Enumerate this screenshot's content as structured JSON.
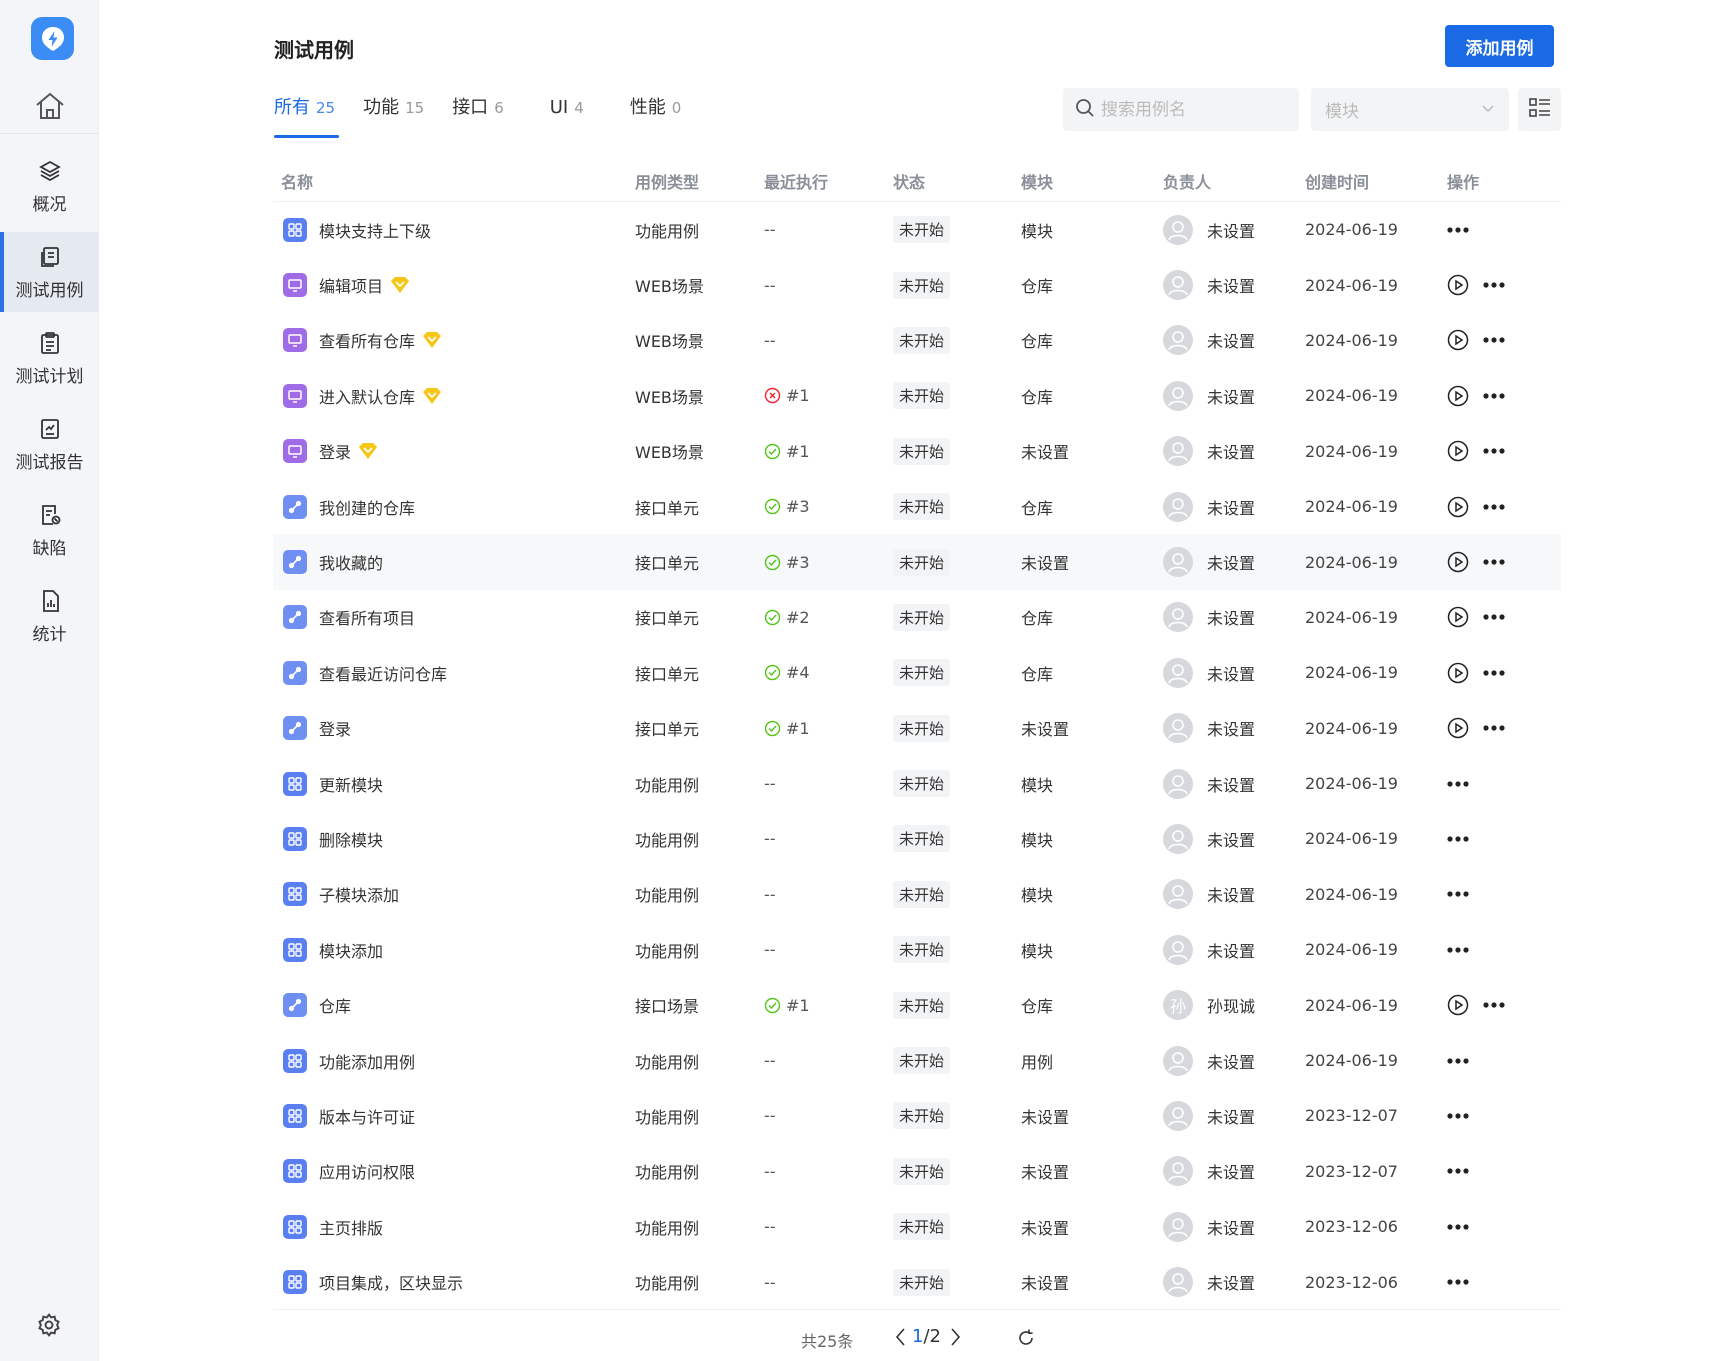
{
  "colors": {
    "primary": "#1b6ae5",
    "sidebar_bg": "#f3f5f8",
    "func_icon": "#5a7ff0",
    "web_icon": "#a06be6",
    "api_icon": "#6f8ff2",
    "vip": "#f5c518",
    "success": "#52c41a",
    "error": "#f5222d"
  },
  "sidebar": {
    "logo_icon": "lightning-logo",
    "home_icon": "home-icon",
    "items": [
      {
        "label": "概况",
        "icon": "layers-icon"
      },
      {
        "label": "测试用例",
        "icon": "test-case-icon",
        "active": true
      },
      {
        "label": "测试计划",
        "icon": "clipboard-icon"
      },
      {
        "label": "测试报告",
        "icon": "report-icon"
      },
      {
        "label": "缺陷",
        "icon": "bug-icon"
      },
      {
        "label": "统计",
        "icon": "chart-icon"
      }
    ],
    "settings_icon": "gear-icon"
  },
  "header": {
    "title": "测试用例",
    "add_button": "添加用例"
  },
  "tabs": [
    {
      "label": "所有",
      "count": "25",
      "active": true
    },
    {
      "label": "功能",
      "count": "15"
    },
    {
      "label": "接口",
      "count": "6"
    },
    {
      "label": "UI",
      "count": "4"
    },
    {
      "label": "性能",
      "count": "0"
    }
  ],
  "filters": {
    "search_placeholder": "搜索用例名",
    "module_placeholder": "模块"
  },
  "table": {
    "columns": [
      "名称",
      "用例类型",
      "最近执行",
      "状态",
      "模块",
      "负责人",
      "创建时间",
      "操作"
    ],
    "rows": [
      {
        "name": "模块支持上下级",
        "kind": "func",
        "vip": false,
        "type": "功能用例",
        "exec": "--",
        "exec_status": "none",
        "status": "未开始",
        "module": "模块",
        "owner": "未设置",
        "avatar": "",
        "date": "2024-06-19",
        "playable": false
      },
      {
        "name": "编辑项目",
        "kind": "web",
        "vip": true,
        "type": "WEB场景",
        "exec": "--",
        "exec_status": "none",
        "status": "未开始",
        "module": "仓库",
        "owner": "未设置",
        "avatar": "",
        "date": "2024-06-19",
        "playable": true
      },
      {
        "name": "查看所有仓库",
        "kind": "web",
        "vip": true,
        "type": "WEB场景",
        "exec": "--",
        "exec_status": "none",
        "status": "未开始",
        "module": "仓库",
        "owner": "未设置",
        "avatar": "",
        "date": "2024-06-19",
        "playable": true
      },
      {
        "name": "进入默认仓库",
        "kind": "web",
        "vip": true,
        "type": "WEB场景",
        "exec": "#1",
        "exec_status": "fail",
        "status": "未开始",
        "module": "仓库",
        "owner": "未设置",
        "avatar": "",
        "date": "2024-06-19",
        "playable": true
      },
      {
        "name": "登录",
        "kind": "web",
        "vip": true,
        "type": "WEB场景",
        "exec": "#1",
        "exec_status": "pass",
        "status": "未开始",
        "module": "未设置",
        "owner": "未设置",
        "avatar": "",
        "date": "2024-06-19",
        "playable": true
      },
      {
        "name": "我创建的仓库",
        "kind": "api",
        "vip": false,
        "type": "接口单元",
        "exec": "#3",
        "exec_status": "pass",
        "status": "未开始",
        "module": "仓库",
        "owner": "未设置",
        "avatar": "",
        "date": "2024-06-19",
        "playable": true
      },
      {
        "name": "我收藏的",
        "kind": "api",
        "vip": false,
        "type": "接口单元",
        "exec": "#3",
        "exec_status": "pass",
        "status": "未开始",
        "module": "未设置",
        "owner": "未设置",
        "avatar": "",
        "date": "2024-06-19",
        "playable": true,
        "hover": true
      },
      {
        "name": "查看所有项目",
        "kind": "api",
        "vip": false,
        "type": "接口单元",
        "exec": "#2",
        "exec_status": "pass",
        "status": "未开始",
        "module": "仓库",
        "owner": "未设置",
        "avatar": "",
        "date": "2024-06-19",
        "playable": true
      },
      {
        "name": "查看最近访问仓库",
        "kind": "api",
        "vip": false,
        "type": "接口单元",
        "exec": "#4",
        "exec_status": "pass",
        "status": "未开始",
        "module": "仓库",
        "owner": "未设置",
        "avatar": "",
        "date": "2024-06-19",
        "playable": true
      },
      {
        "name": "登录",
        "kind": "api",
        "vip": false,
        "type": "接口单元",
        "exec": "#1",
        "exec_status": "pass",
        "status": "未开始",
        "module": "未设置",
        "owner": "未设置",
        "avatar": "",
        "date": "2024-06-19",
        "playable": true
      },
      {
        "name": "更新模块",
        "kind": "func",
        "vip": false,
        "type": "功能用例",
        "exec": "--",
        "exec_status": "none",
        "status": "未开始",
        "module": "模块",
        "owner": "未设置",
        "avatar": "",
        "date": "2024-06-19",
        "playable": false
      },
      {
        "name": "删除模块",
        "kind": "func",
        "vip": false,
        "type": "功能用例",
        "exec": "--",
        "exec_status": "none",
        "status": "未开始",
        "module": "模块",
        "owner": "未设置",
        "avatar": "",
        "date": "2024-06-19",
        "playable": false
      },
      {
        "name": "子模块添加",
        "kind": "func",
        "vip": false,
        "type": "功能用例",
        "exec": "--",
        "exec_status": "none",
        "status": "未开始",
        "module": "模块",
        "owner": "未设置",
        "avatar": "",
        "date": "2024-06-19",
        "playable": false
      },
      {
        "name": "模块添加",
        "kind": "func",
        "vip": false,
        "type": "功能用例",
        "exec": "--",
        "exec_status": "none",
        "status": "未开始",
        "module": "模块",
        "owner": "未设置",
        "avatar": "",
        "date": "2024-06-19",
        "playable": false
      },
      {
        "name": "仓库",
        "kind": "api",
        "vip": false,
        "type": "接口场景",
        "exec": "#1",
        "exec_status": "pass",
        "status": "未开始",
        "module": "仓库",
        "owner": "孙现诚",
        "avatar": "孙",
        "date": "2024-06-19",
        "playable": true
      },
      {
        "name": "功能添加用例",
        "kind": "func",
        "vip": false,
        "type": "功能用例",
        "exec": "--",
        "exec_status": "none",
        "status": "未开始",
        "module": "用例",
        "owner": "未设置",
        "avatar": "",
        "date": "2024-06-19",
        "playable": false
      },
      {
        "name": "版本与许可证",
        "kind": "func",
        "vip": false,
        "type": "功能用例",
        "exec": "--",
        "exec_status": "none",
        "status": "未开始",
        "module": "未设置",
        "owner": "未设置",
        "avatar": "",
        "date": "2023-12-07",
        "playable": false
      },
      {
        "name": "应用访问权限",
        "kind": "func",
        "vip": false,
        "type": "功能用例",
        "exec": "--",
        "exec_status": "none",
        "status": "未开始",
        "module": "未设置",
        "owner": "未设置",
        "avatar": "",
        "date": "2023-12-07",
        "playable": false
      },
      {
        "name": "主页排版",
        "kind": "func",
        "vip": false,
        "type": "功能用例",
        "exec": "--",
        "exec_status": "none",
        "status": "未开始",
        "module": "未设置",
        "owner": "未设置",
        "avatar": "",
        "date": "2023-12-06",
        "playable": false
      },
      {
        "name": "项目集成，区块显示",
        "kind": "func",
        "vip": false,
        "type": "功能用例",
        "exec": "--",
        "exec_status": "none",
        "status": "未开始",
        "module": "未设置",
        "owner": "未设置",
        "avatar": "",
        "date": "2023-12-06",
        "playable": false
      }
    ]
  },
  "pagination": {
    "total": "共25条",
    "current": "1",
    "separator": "/",
    "pages": "2"
  }
}
